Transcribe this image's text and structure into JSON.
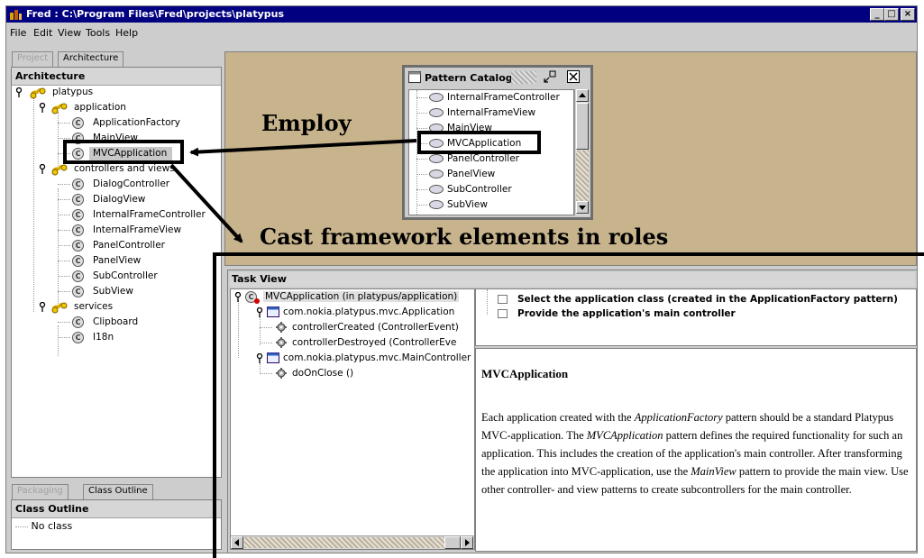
{
  "window": {
    "title": "Fred : C:\\Program Files\\Fred\\projects\\platypus",
    "controls": [
      "_",
      "□",
      "×"
    ]
  },
  "menu": [
    "File",
    "Edit",
    "View",
    "Tools",
    "Help"
  ],
  "left_panel": {
    "tabs": [
      "Project",
      "Architecture"
    ],
    "header": "Architecture",
    "tree": {
      "root": "platypus",
      "groups": [
        {
          "label": "application",
          "items": [
            "ApplicationFactory",
            "MainView",
            "MVCApplication"
          ]
        },
        {
          "label": "controllers and views",
          "items": [
            "DialogController",
            "DialogView",
            "InternalFrameController",
            "InternalFrameView",
            "PanelController",
            "PanelView",
            "SubController",
            "SubView"
          ]
        },
        {
          "label": "services",
          "items": [
            "Clipboard",
            "I18n"
          ]
        }
      ],
      "selected": "MVCApplication"
    },
    "class_icon_letter": "C"
  },
  "outline_panel": {
    "tabs": [
      "Packaging",
      "Class Outline"
    ],
    "header": "Class Outline",
    "empty_text": "No class"
  },
  "pattern_catalog": {
    "title": "Pattern Catalog",
    "items": [
      "InternalFrameController",
      "InternalFrameView",
      "MainView",
      "MVCApplication",
      "PanelController",
      "PanelView",
      "SubController",
      "SubView"
    ],
    "highlighted": "MVCApplication"
  },
  "annotations": {
    "employ": "Employ",
    "cast": "Cast framework elements in roles"
  },
  "task_view": {
    "header": "Task View",
    "tree": {
      "root": "MVCApplication (in platypus/application)",
      "children": [
        {
          "label": "com.nokia.platypus.mvc.Application",
          "methods": [
            "controllerCreated (ControllerEvent)",
            "controllerDestroyed (ControllerEve"
          ]
        },
        {
          "label": "com.nokia.platypus.mvc.MainController",
          "methods": [
            "doOnClose ()"
          ]
        }
      ]
    },
    "tasks": [
      "Select the application class (created in the ApplicationFactory pattern)",
      "Provide the application's main controller"
    ],
    "description_title": "MVCApplication",
    "description": {
      "p1": "Each application created with the ",
      "p1_italic": "ApplicationFactory",
      "p2": " pattern should be a standard Platypus MVC-application. The ",
      "p2_italic": "MVCApplication",
      "p3": " pattern defines the required functionality for such an application. This includes the creation of the application's main controller. After transforming the application into MVC-application, use the ",
      "p3_italic": "MainView",
      "p4": " pattern to provide the main view. Use other controller- and view patterns to create subcontrollers for the main controller."
    }
  }
}
